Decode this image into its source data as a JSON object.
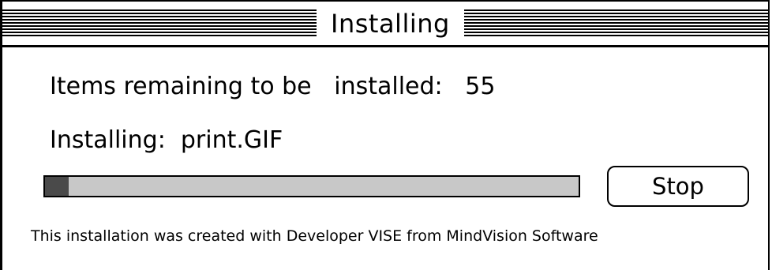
{
  "window": {
    "title": "Installing"
  },
  "status": {
    "items_remaining_label": "Items remaining to be   installed:",
    "items_remaining_count": "55",
    "installing_label": "Installing:",
    "installing_file": "print.GIF"
  },
  "progress": {
    "fraction": 0.045
  },
  "buttons": {
    "stop_label": "Stop"
  },
  "footer": {
    "credit": "This installation was created with Developer VISE from MindVision Software"
  }
}
